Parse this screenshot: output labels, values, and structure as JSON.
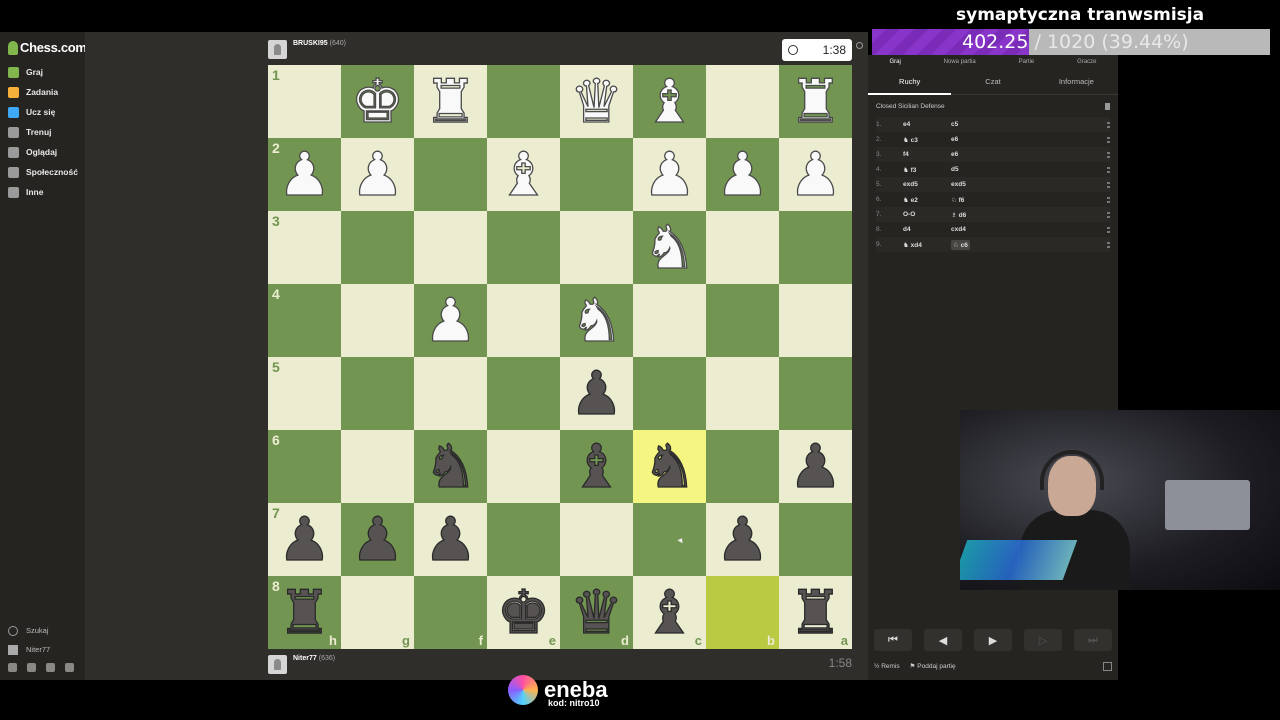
{
  "overlay": {
    "title": "symaptyczna tranwsmisja",
    "goal_current": "402.25",
    "goal_rest": " / 1020 (39.44%)",
    "goal_fraction": 0.3944
  },
  "sidebar": {
    "logo": "Chess.com",
    "items": [
      {
        "label": "Graj",
        "icon": "play-icon",
        "color": "#81b64c"
      },
      {
        "label": "Zadania",
        "icon": "puzzle-icon",
        "color": "#f7b13b"
      },
      {
        "label": "Ucz się",
        "icon": "learn-icon",
        "color": "#3fa9f5"
      },
      {
        "label": "Trenuj",
        "icon": "train-icon",
        "color": "#9a9a9a"
      },
      {
        "label": "Oglądaj",
        "icon": "watch-icon",
        "color": "#9a9a9a"
      },
      {
        "label": "Społeczność",
        "icon": "community-icon",
        "color": "#9a9a9a"
      },
      {
        "label": "Inne",
        "icon": "more-icon",
        "color": "#9a9a9a"
      }
    ],
    "search_label": "Szukaj",
    "user_label": "Niter77"
  },
  "players": {
    "top": {
      "name": "BRUSKI95",
      "rating": "(640)",
      "clock": "1:38"
    },
    "bottom": {
      "name": "Niter77",
      "rating": "(636)",
      "clock": "1:58"
    }
  },
  "board": {
    "ranks": [
      "1",
      "2",
      "3",
      "4",
      "5",
      "6",
      "7",
      "8"
    ],
    "files": [
      "h",
      "g",
      "f",
      "e",
      "d",
      "c",
      "b",
      "a"
    ],
    "squares": [
      [
        "",
        "wK",
        "wR",
        "",
        "wQ",
        "wB",
        "",
        "wR"
      ],
      [
        "wP",
        "wP",
        "",
        "wB",
        "",
        "wP",
        "wP",
        "wP"
      ],
      [
        "",
        "",
        "",
        "",
        "",
        "wN",
        "",
        ""
      ],
      [
        "",
        "",
        "wP",
        "",
        "wN",
        "",
        "",
        ""
      ],
      [
        "",
        "",
        "",
        "",
        "bP",
        "",
        "",
        ""
      ],
      [
        "",
        "",
        "bN",
        "",
        "bB",
        "bN",
        "",
        "bP"
      ],
      [
        "bP",
        "bP",
        "bP",
        "",
        "",
        "",
        "bP",
        ""
      ],
      [
        "bR",
        "",
        "",
        "bK",
        "bQ",
        "bB",
        "",
        "bR"
      ]
    ],
    "highlights": [
      [
        5,
        5
      ],
      [
        7,
        6
      ]
    ]
  },
  "panel": {
    "top_tabs": [
      "Graj",
      "Nowa partia",
      "Partie",
      "Gracze"
    ],
    "tabs": [
      "Ruchy",
      "Czat",
      "Informacje"
    ],
    "opening": "Closed Sicilian Defense",
    "moves": [
      {
        "n": "1.",
        "w": "e4",
        "b": "c5"
      },
      {
        "n": "2.",
        "w": "♞ c3",
        "b": "e6"
      },
      {
        "n": "3.",
        "w": "f4",
        "b": "e6"
      },
      {
        "n": "4.",
        "w": "♞ f3",
        "b": "d5"
      },
      {
        "n": "5.",
        "w": "exd5",
        "b": "exd5"
      },
      {
        "n": "6.",
        "w": "♞ e2",
        "b": "♘ f6"
      },
      {
        "n": "7.",
        "w": "O-O",
        "b": "♗ d6"
      },
      {
        "n": "8.",
        "w": "d4",
        "b": "cxd4"
      },
      {
        "n": "9.",
        "w": "♞ xd4",
        "b": "♘ c6"
      }
    ],
    "controls": [
      "⏮",
      "◀",
      "▶",
      "▷",
      "⏭"
    ],
    "footer_draw": "½ Remis",
    "footer_resign": "Poddaj partię"
  },
  "banner": {
    "brand": "eneba",
    "code": "kod: nitro10"
  }
}
